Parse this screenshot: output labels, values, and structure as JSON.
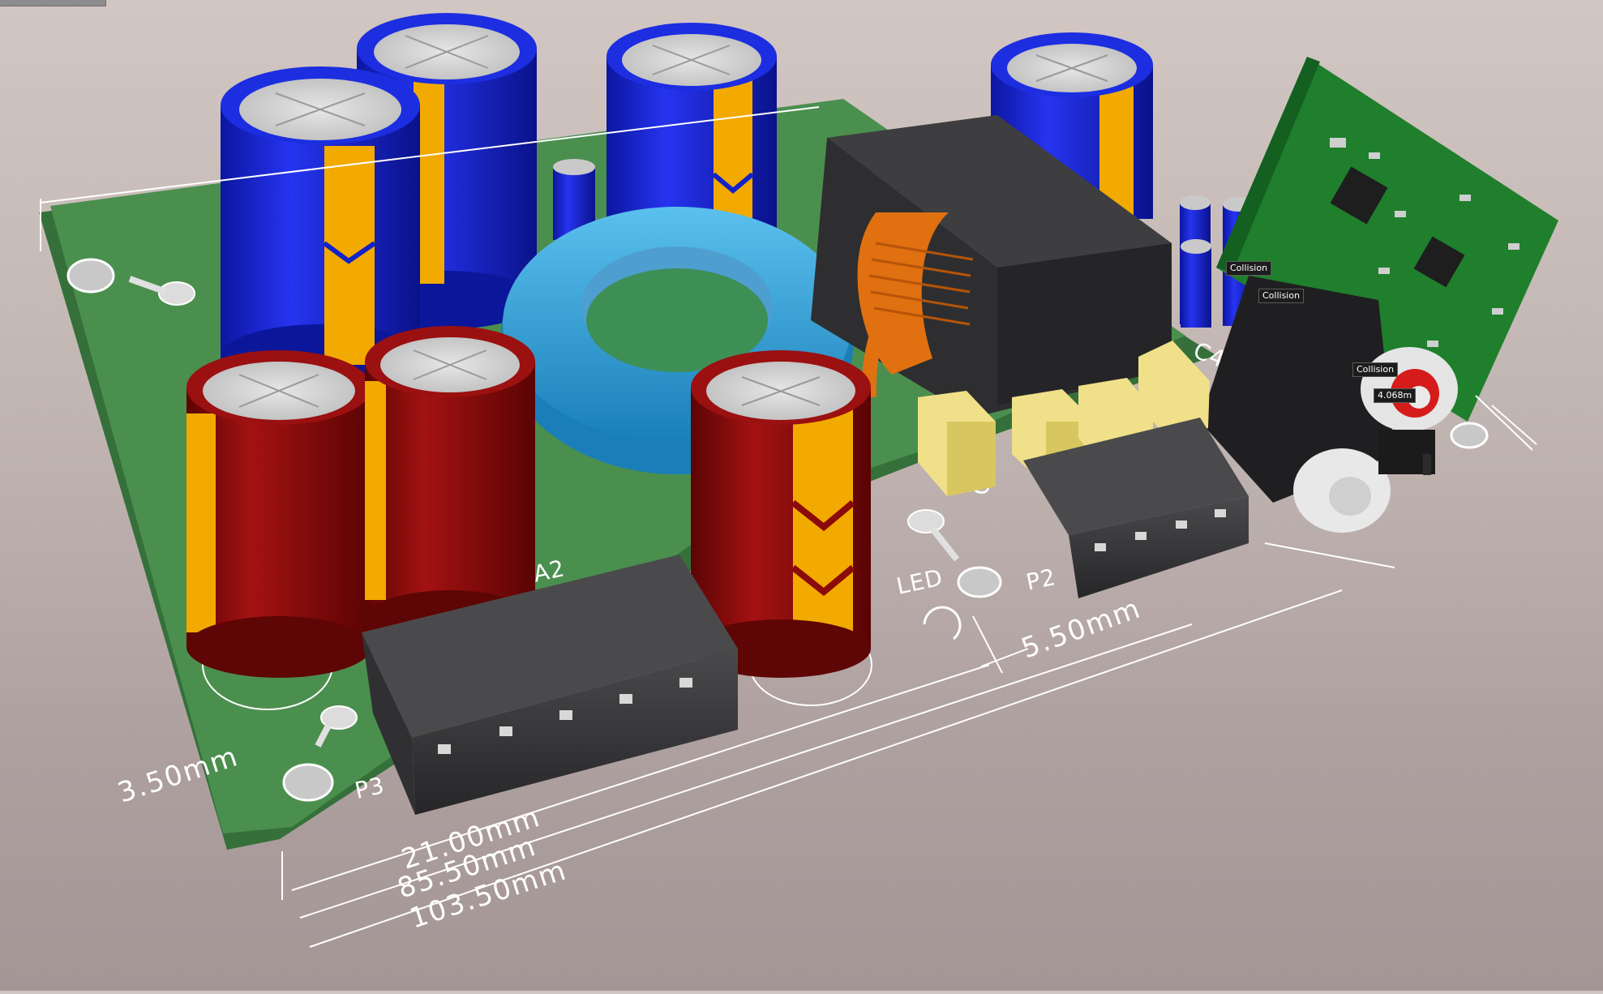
{
  "window": {
    "title": ""
  },
  "board": {
    "silkscreen": {
      "ca2": "CA2",
      "led": "LED",
      "p2": "P2",
      "p3": "P3",
      "c9c": "C9C",
      "c4": "C4",
      "c_left": "C"
    }
  },
  "dimensions": {
    "d1": "21.00mm",
    "d2": "85.50mm",
    "d3": "103.50mm",
    "d4": "3.50mm",
    "d5": "5.50mm"
  },
  "tags": {
    "collision_1": "Collision",
    "collision_2": "Collision",
    "collision_3": "Collision",
    "measure": "4.068m"
  },
  "colors": {
    "pcb": "#4b8f4e",
    "cap_blue": "#1626d8",
    "cap_red": "#8b0a0a",
    "stripe": "#f2a900",
    "toroid": "#2a9ad6",
    "connector": "#3a3a3c",
    "capacitor_film": "#f0e08a"
  }
}
